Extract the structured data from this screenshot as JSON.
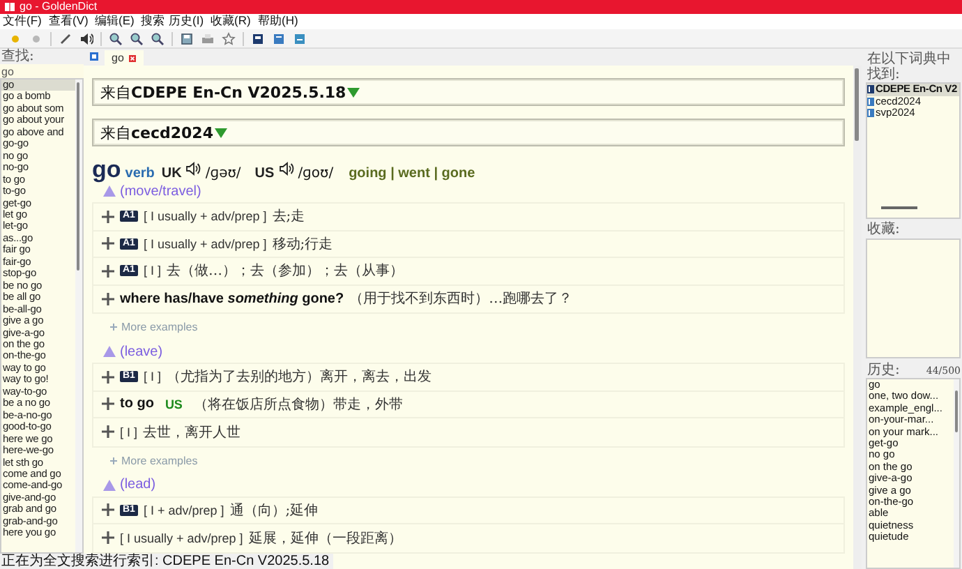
{
  "window": {
    "title": "go - GoldenDict"
  },
  "menu": [
    "文件(F)",
    "查看(V)",
    "编辑(E)",
    "搜索",
    "历史(I)",
    "收藏(R)",
    "帮助(H)"
  ],
  "search": {
    "label": "查找:",
    "value": "go"
  },
  "word_list": [
    {
      "text": "go",
      "selected": true
    },
    {
      "text": "go a bomb",
      "selected": false
    },
    {
      "text": "go about som",
      "selected": false
    },
    {
      "text": "go about your",
      "selected": false
    },
    {
      "text": "go above and",
      "selected": false
    },
    {
      "text": "go-go",
      "selected": false
    },
    {
      "text": "no go",
      "selected": false
    },
    {
      "text": "no-go",
      "selected": false
    },
    {
      "text": "to go",
      "selected": false
    },
    {
      "text": "to-go",
      "selected": false
    },
    {
      "text": "get-go",
      "selected": false
    },
    {
      "text": "let go",
      "selected": false
    },
    {
      "text": "let-go",
      "selected": false
    },
    {
      "text": "as...go",
      "selected": false
    },
    {
      "text": "fair go",
      "selected": false
    },
    {
      "text": "fair-go",
      "selected": false
    },
    {
      "text": "stop-go",
      "selected": false
    },
    {
      "text": "be no go",
      "selected": false
    },
    {
      "text": "be all go",
      "selected": false
    },
    {
      "text": "be-all-go",
      "selected": false
    },
    {
      "text": "give a go",
      "selected": false
    },
    {
      "text": "give-a-go",
      "selected": false
    },
    {
      "text": "on the go",
      "selected": false
    },
    {
      "text": "on-the-go",
      "selected": false
    },
    {
      "text": "way to go",
      "selected": false
    },
    {
      "text": "way to go!",
      "selected": false
    },
    {
      "text": "way-to-go",
      "selected": false
    },
    {
      "text": "be a no go",
      "selected": false
    },
    {
      "text": "be-a-no-go",
      "selected": false
    },
    {
      "text": "good-to-go",
      "selected": false
    },
    {
      "text": "here we go",
      "selected": false
    },
    {
      "text": "here-we-go",
      "selected": false
    },
    {
      "text": "let sth go",
      "selected": false
    },
    {
      "text": "come and go",
      "selected": false
    },
    {
      "text": "come-and-go",
      "selected": false
    },
    {
      "text": "give-and-go",
      "selected": false
    },
    {
      "text": "grab and go",
      "selected": false
    },
    {
      "text": "grab-and-go",
      "selected": false
    },
    {
      "text": "here you go",
      "selected": false
    }
  ],
  "tabs": [
    {
      "label": "go",
      "selected": true
    }
  ],
  "article": {
    "dictionaries": [
      {
        "header": "来自**CDEPE En-Cn V2025.5.18**"
      },
      {
        "header": "来自**cecd2024**"
      }
    ],
    "entry": {
      "headword": "go",
      "pos": "verb",
      "pronunciations": [
        {
          "region": "UK",
          "ipa": "/ɡəʊ/"
        },
        {
          "region": "US",
          "ipa": "/ɡoʊ/"
        }
      ],
      "forms": "going | went | gone",
      "sense_groups": [
        {
          "label": "(move/travel)",
          "more": "More examples",
          "senses": [
            {
              "badge": "A1",
              "grammar": "[ I usually + adv/prep ]",
              "text": "去;走"
            },
            {
              "badge": "A1",
              "grammar": "[ I usually + adv/prep ]",
              "text": "移动;行走"
            },
            {
              "badge": "A1",
              "grammar": "[ I ]",
              "text": "去（做…）；去（参加）；去（从事）"
            },
            {
              "phrase": "where has/have *something* gone?",
              "text": "（用于找不到东西时）…跑哪去了？"
            }
          ]
        },
        {
          "label": "(leave)",
          "more": "More examples",
          "senses": [
            {
              "badge": "B1",
              "grammar": "[ I ]",
              "text": "（尤指为了去别的地方）离开，离去，出发"
            },
            {
              "phrase": "to go",
              "region": "US",
              "text": "（将在饭店所点食物）带走，外带"
            },
            {
              "grammar": "[ I ]",
              "text": "去世，离开人世"
            }
          ]
        },
        {
          "label": "(lead)",
          "senses": [
            {
              "badge": "B1",
              "grammar": "[ I + adv/prep ]",
              "text": "通（向）;延伸"
            },
            {
              "grammar": "[ I usually + adv/prep ]",
              "text": "延展，延伸（一段距离）"
            }
          ]
        }
      ]
    }
  },
  "found_in": {
    "label": "在以下词典中找到:",
    "items": [
      {
        "name": "CDEPE En-Cn V2",
        "selected": true
      },
      {
        "name": "cecd2024",
        "selected": false
      },
      {
        "name": "svp2024",
        "selected": false
      }
    ]
  },
  "favorites": {
    "label": "收藏:"
  },
  "history": {
    "label": "历史:",
    "count": "44/500",
    "items": [
      "go",
      "one, two dow...",
      "example_engl...",
      "on-your-mar...",
      "on your mark...",
      "get-go",
      "no go",
      "on the go",
      "give-a-go",
      "give a go",
      "on-the-go",
      "able",
      "quietness",
      "quietude"
    ]
  },
  "status_bar": "正在为全文搜索进行索引:  CDEPE En-Cn V2025.5.18"
}
